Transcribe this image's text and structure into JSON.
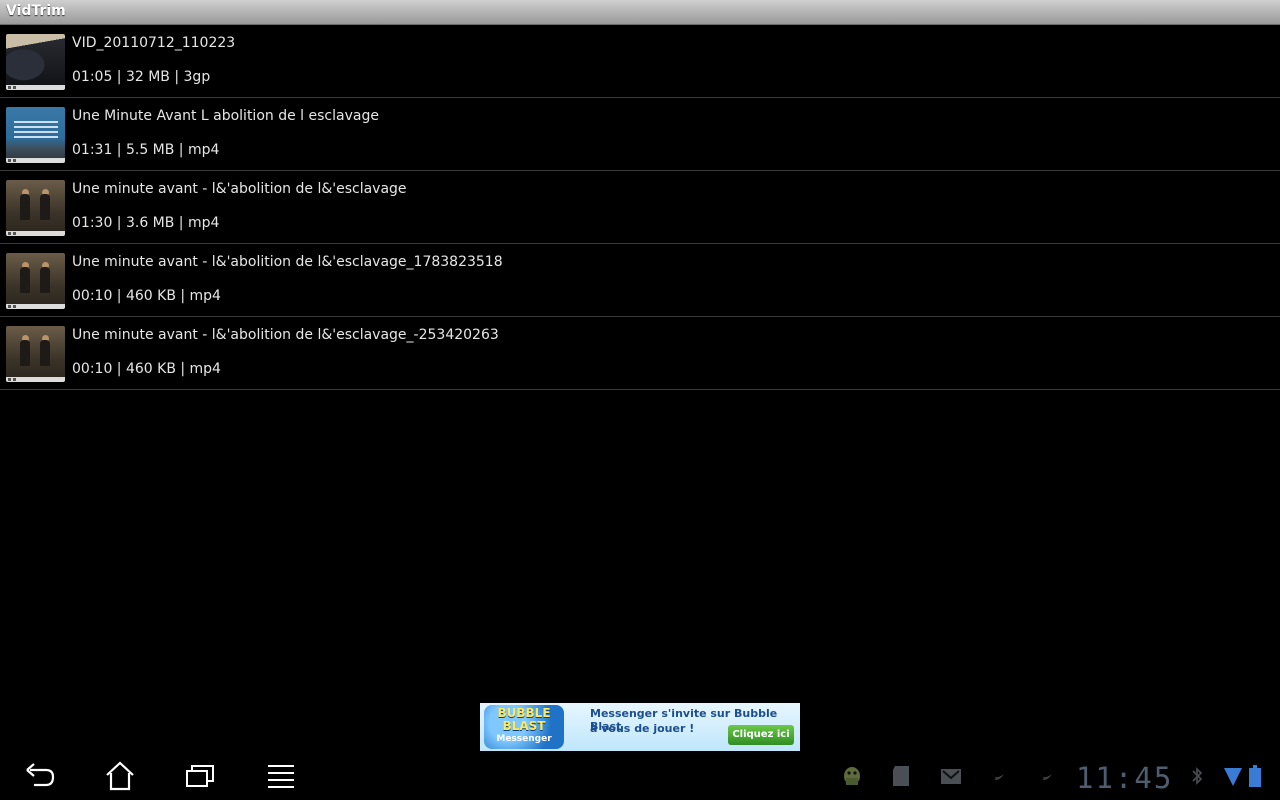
{
  "app": {
    "title": "VidTrim"
  },
  "videos": [
    {
      "name": "VID_20110712_110223",
      "meta": "01:05 | 32 MB | 3gp"
    },
    {
      "name": "Une Minute Avant L abolition de l esclavage",
      "meta": "01:31 | 5.5 MB | mp4"
    },
    {
      "name": "Une minute avant - l&'abolition de l&'esclavage",
      "meta": "01:30 | 3.6 MB | mp4"
    },
    {
      "name": "Une minute avant - l&'abolition de l&'esclavage_1783823518",
      "meta": "00:10 | 460 KB | mp4"
    },
    {
      "name": "Une minute avant - l&'abolition de l&'esclavage_-253420263",
      "meta": "00:10 | 460 KB | mp4"
    }
  ],
  "ad": {
    "logo_line1": "BUBBLE",
    "logo_line2": "BLAST",
    "logo_line3": "Messenger",
    "line1": "Messenger s'invite sur Bubble Blast",
    "line2": "à vous de jouer !",
    "cta": "Cliquez ici"
  },
  "navigation": {
    "buttons": [
      "back-icon",
      "home-icon",
      "recent-apps-icon",
      "menu-icon"
    ]
  },
  "status_bar": {
    "time": "11:45",
    "icons": [
      "android-icon",
      "sd-card-icon",
      "gmail-icon",
      "twitter-icon",
      "twitter-icon",
      "bluetooth-icon",
      "wifi-icon",
      "battery-icon"
    ],
    "colors": {
      "icon": "#4f5d70",
      "wifi": "#3a7bd5",
      "battery": "#3a7bd5"
    }
  }
}
